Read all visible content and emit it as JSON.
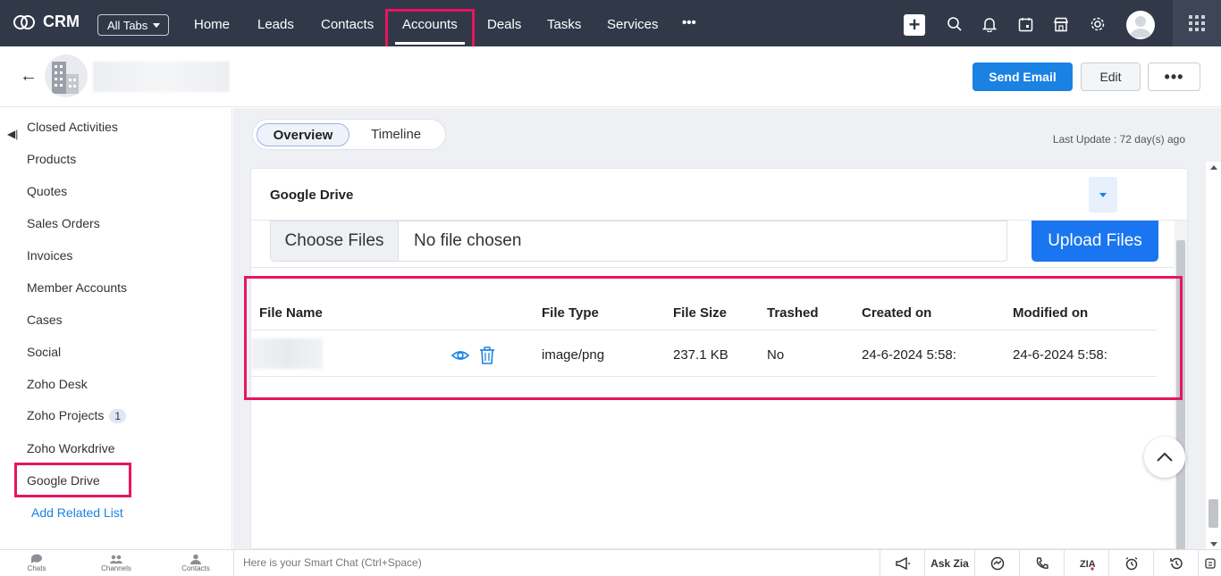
{
  "topbar": {
    "app_name": "CRM",
    "all_tabs_label": "All Tabs",
    "nav": [
      "Home",
      "Leads",
      "Contacts",
      "Accounts",
      "Deals",
      "Tasks",
      "Services"
    ],
    "active_nav": "Accounts",
    "more_label": "•••"
  },
  "record_header": {
    "send_email_label": "Send Email",
    "edit_label": "Edit",
    "more_label": "•••"
  },
  "sidebar": {
    "items": [
      {
        "label": "Closed Activities"
      },
      {
        "label": "Products"
      },
      {
        "label": "Quotes"
      },
      {
        "label": "Sales Orders"
      },
      {
        "label": "Invoices"
      },
      {
        "label": "Member Accounts"
      },
      {
        "label": "Cases"
      },
      {
        "label": "Social"
      },
      {
        "label": "Zoho Desk"
      },
      {
        "label": "Zoho Projects",
        "badge": "1"
      },
      {
        "label": "Zoho Workdrive"
      },
      {
        "label": "Google Drive"
      }
    ],
    "add_related_label": "Add Related List"
  },
  "main": {
    "tabs": [
      "Overview",
      "Timeline"
    ],
    "active_tab": "Overview",
    "last_update": "Last Update : 72 day(s) ago"
  },
  "google_drive": {
    "title": "Google Drive",
    "choose_files_label": "Choose Files",
    "no_file_label": "No file chosen",
    "upload_label": "Upload Files",
    "columns": [
      "File Name",
      "File Type",
      "File Size",
      "Trashed",
      "Created on",
      "Modified on"
    ],
    "rows": [
      {
        "file_type": "image/png",
        "file_size": "237.1 KB",
        "trashed": "No",
        "created_on": "24-6-2024 5:58:",
        "modified_on": "24-6-2024 5:58:"
      }
    ]
  },
  "bottombar": {
    "chats": "Chats",
    "channels": "Channels",
    "contacts": "Contacts",
    "smartchat_placeholder": "Here is your Smart Chat (Ctrl+Space)",
    "ask_zia": "Ask Zia"
  },
  "colors": {
    "topbar_bg": "#313949",
    "primary": "#1a82e2",
    "highlight": "#e8155e"
  }
}
